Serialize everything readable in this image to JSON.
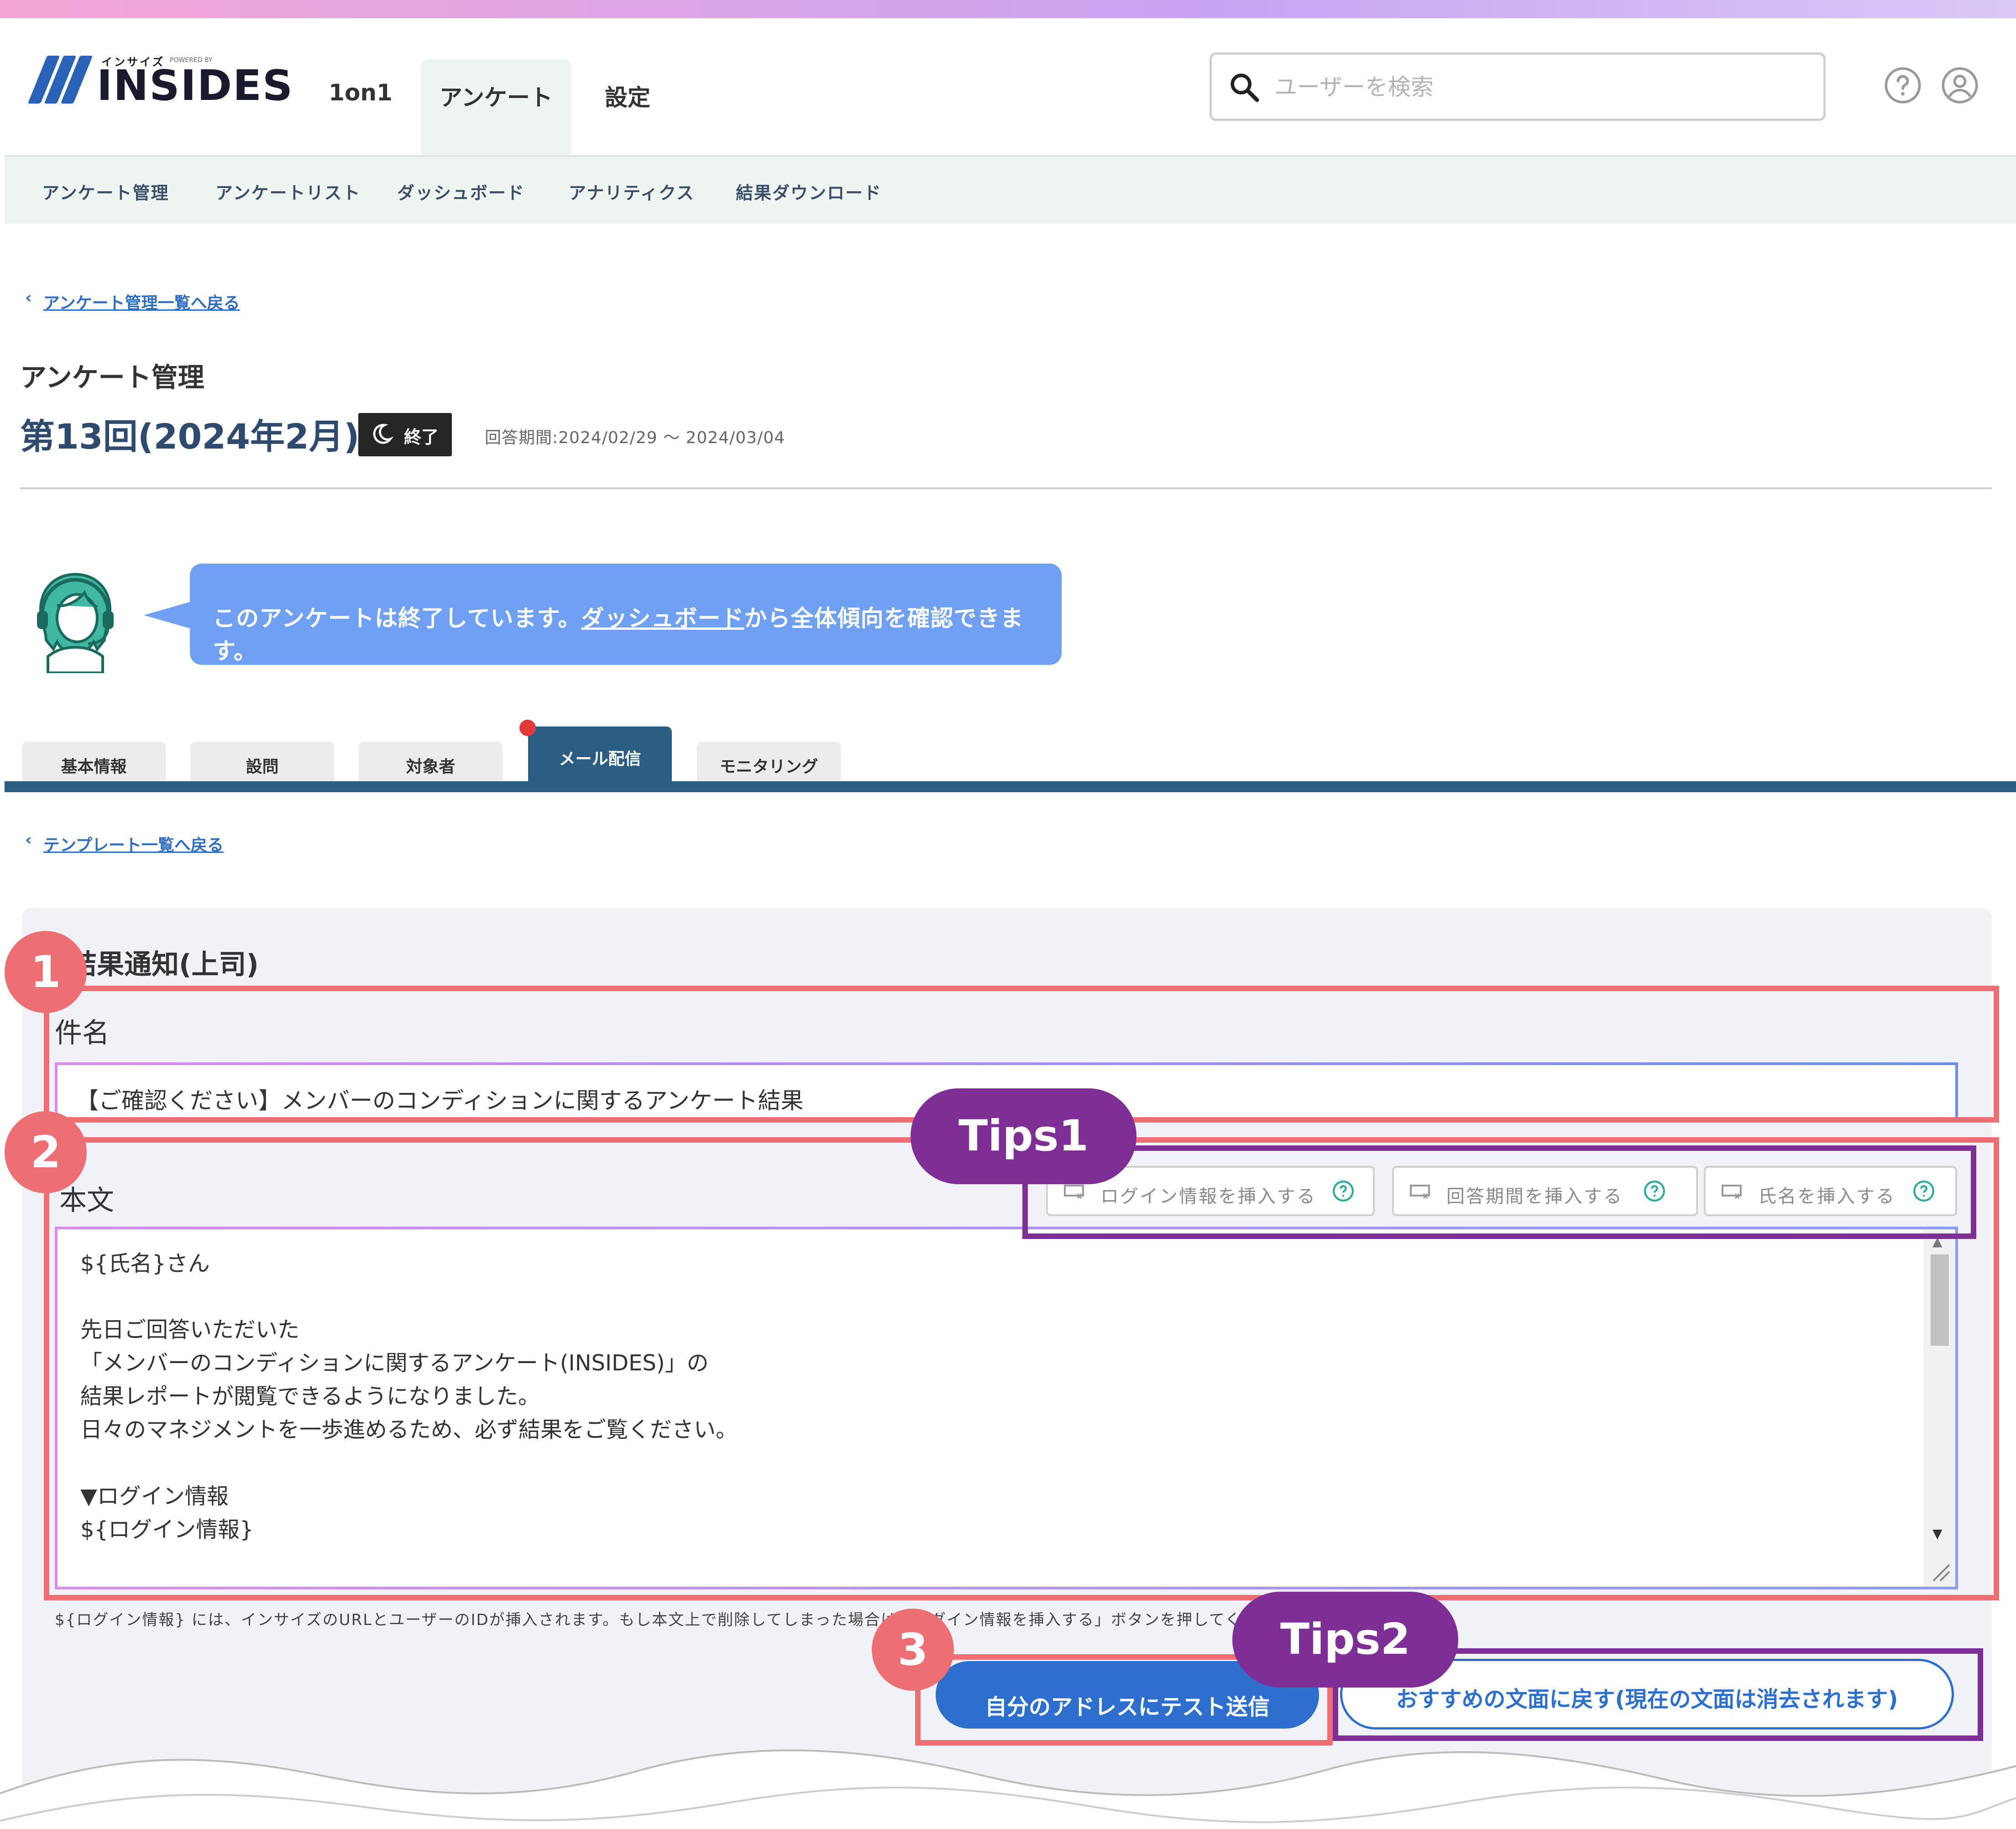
{
  "header": {
    "logo_small": "インサイズ",
    "logo_powered": "POWERED BY",
    "logo_text": "INSIDES",
    "nav": [
      {
        "label": "1on1"
      },
      {
        "label": "アンケート"
      },
      {
        "label": "設定"
      }
    ],
    "search_placeholder": "ユーザーを検索"
  },
  "subnav": [
    "アンケート管理",
    "アンケートリスト",
    "ダッシュボード",
    "アナリティクス",
    "結果ダウンロード"
  ],
  "back_to_list": "アンケート管理一覧へ戻る",
  "page_heading": "アンケート管理",
  "survey": {
    "title": "第13回(2024年2月)",
    "status": "終了",
    "period": "回答期間:2024/02/29 ～ 2024/03/04"
  },
  "notice": {
    "text_before": "このアンケートは終了しています。",
    "link": "ダッシュボード",
    "text_after": "から全体傾向を確認できます。"
  },
  "tabs": [
    "基本情報",
    "設問",
    "対象者",
    "メール配信",
    "モニタリング"
  ],
  "back_to_templates": "テンプレート一覧へ戻る",
  "form": {
    "section_title": "結果通知(上司)",
    "subject_label": "件名",
    "subject_value": "【ご確認ください】メンバーのコンディションに関するアンケート結果",
    "body_label": "本文",
    "insert_buttons": [
      "ログイン情報を挿入する",
      "回答期間を挿入する",
      "氏名を挿入する"
    ],
    "body_lines": [
      "${氏名}さん",
      "",
      "先日ご回答いただいた",
      "「メンバーのコンディションに関するアンケート(INSIDES)」の",
      "結果レポートが閲覧できるようになりました。",
      "日々のマネジメントを一歩進めるため、必ず結果をご覧ください。",
      "",
      "▼ログイン情報",
      "${ログイン情報}"
    ],
    "note": "${ログイン情報} には、インサイズのURLとユーザーのIDが挿入されます。もし本文上で削除してしまった場合は「ログイン情報を挿入する」ボタンを押してください。",
    "test_send": "自分のアドレスにテスト送信",
    "reset": "おすすめの文面に戻す(現在の文面は消去されます)"
  },
  "annotations": {
    "numbers": [
      "1",
      "2",
      "3"
    ],
    "tips": [
      "Tips1",
      "Tips2"
    ],
    "colors": {
      "red": "#ee6f73",
      "purple": "#7d2f96"
    }
  }
}
